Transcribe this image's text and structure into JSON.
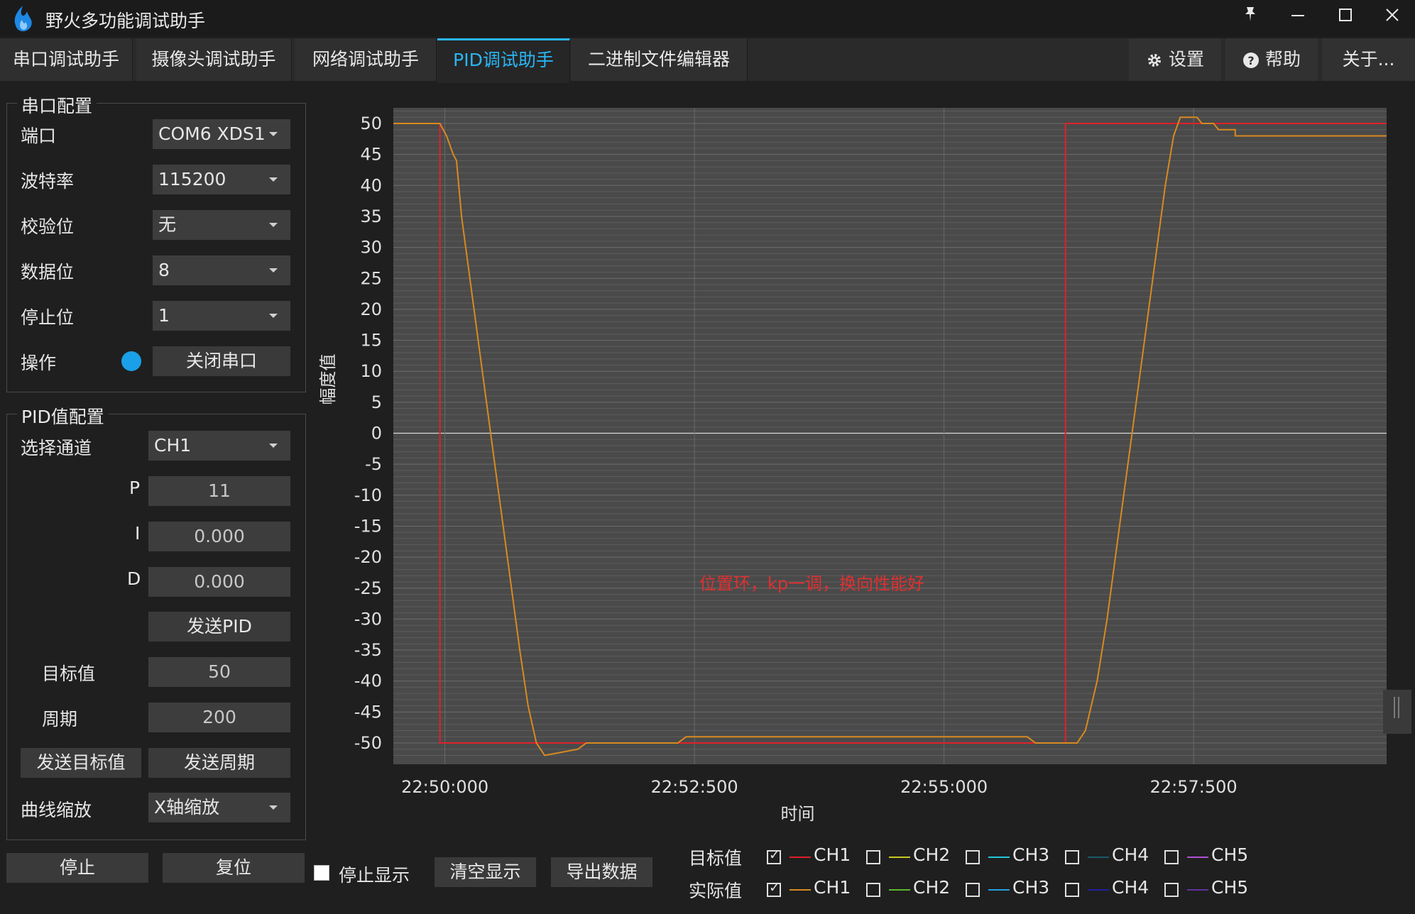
{
  "window": {
    "title": "野火多功能调试助手",
    "pin_icon": "pin-icon",
    "minimize_icon": "minimize-icon",
    "maximize_icon": "maximize-icon",
    "close_icon": "close-icon"
  },
  "tabs": [
    {
      "label": "串口调试助手",
      "active": false
    },
    {
      "label": "摄像头调试助手",
      "active": false
    },
    {
      "label": "网络调试助手",
      "active": false
    },
    {
      "label": "PID调试助手",
      "active": true
    },
    {
      "label": "二进制文件编辑器",
      "active": false
    }
  ],
  "right_tabs": {
    "settings": "设置",
    "help": "帮助",
    "about": "关于..."
  },
  "serial_config": {
    "title": "串口配置",
    "port_label": "端口",
    "port_value": "COM6 XDS1",
    "baud_label": "波特率",
    "baud_value": "115200",
    "parity_label": "校验位",
    "parity_value": "无",
    "databits_label": "数据位",
    "databits_value": "8",
    "stopbits_label": "停止位",
    "stopbits_value": "1",
    "operation_label": "操作",
    "close_port_button": "关闭串口",
    "status_color": "#1aa0e8"
  },
  "pid_config": {
    "title": "PID值配置",
    "channel_label": "选择通道",
    "channel_value": "CH1",
    "p_label": "P",
    "p_value": "11",
    "i_label": "I",
    "i_value": "0.000",
    "d_label": "D",
    "d_value": "0.000",
    "send_pid_button": "发送PID",
    "target_label": "目标值",
    "target_value": "50",
    "period_label": "周期",
    "period_value": "200",
    "send_target_button": "发送目标值",
    "send_period_button": "发送周期",
    "zoom_label": "曲线缩放",
    "zoom_value": "X轴缩放"
  },
  "bottom_controls": {
    "stop_button": "停止",
    "reset_button": "复位",
    "stop_display_label": "停止显示",
    "stop_display_checked": false,
    "clear_display_button": "清空显示",
    "export_data_button": "导出数据"
  },
  "legend": {
    "target_label": "目标值",
    "actual_label": "实际值",
    "target_channels": [
      {
        "name": "CH1",
        "checked": true,
        "color": "#e0202a"
      },
      {
        "name": "CH2",
        "checked": false,
        "color": "#c8c820"
      },
      {
        "name": "CH3",
        "checked": false,
        "color": "#20c8d8"
      },
      {
        "name": "CH4",
        "checked": false,
        "color": "#1a5a6a"
      },
      {
        "name": "CH5",
        "checked": false,
        "color": "#b050d0"
      }
    ],
    "actual_channels": [
      {
        "name": "CH1",
        "checked": true,
        "color": "#d88a20"
      },
      {
        "name": "CH2",
        "checked": false,
        "color": "#5ab82a"
      },
      {
        "name": "CH3",
        "checked": false,
        "color": "#20a0e0"
      },
      {
        "name": "CH4",
        "checked": false,
        "color": "#2020a0"
      },
      {
        "name": "CH5",
        "checked": false,
        "color": "#6030a0"
      }
    ]
  },
  "chart_data": {
    "type": "line",
    "xlabel": "时间",
    "ylabel": "幅度值",
    "ylim": [
      -50,
      50
    ],
    "yticks": [
      50,
      45,
      40,
      35,
      30,
      25,
      20,
      15,
      10,
      5,
      0,
      -5,
      -10,
      -15,
      -20,
      -25,
      -30,
      -35,
      -40,
      -45,
      -50
    ],
    "xticks": [
      "22:50:000",
      "22:52:500",
      "22:55:000",
      "22:57:500"
    ],
    "xtick_values": [
      0,
      150,
      300,
      450
    ],
    "xlim": [
      -31,
      566
    ],
    "annotation": "位置环，kp一调，换向性能好",
    "annotation_color": "#e03030",
    "grid": true,
    "series": [
      {
        "channel": "CH1 目标值",
        "color": "#e0202a",
        "points": [
          [
            -31,
            50
          ],
          [
            -3,
            50
          ],
          [
            -3,
            -50
          ],
          [
            373,
            -50
          ],
          [
            373,
            50
          ],
          [
            566,
            50
          ]
        ]
      },
      {
        "channel": "CH1 实际值",
        "color": "#d88a20",
        "points": [
          [
            -31,
            50
          ],
          [
            -3,
            50
          ],
          [
            1,
            48
          ],
          [
            5,
            45
          ],
          [
            7,
            44
          ],
          [
            10,
            35
          ],
          [
            15,
            25
          ],
          [
            20,
            15
          ],
          [
            25,
            5
          ],
          [
            30,
            -5
          ],
          [
            35,
            -15
          ],
          [
            40,
            -25
          ],
          [
            45,
            -35
          ],
          [
            50,
            -44
          ],
          [
            55,
            -50
          ],
          [
            60,
            -52
          ],
          [
            80,
            -51
          ],
          [
            85,
            -50
          ],
          [
            140,
            -50
          ],
          [
            145,
            -49
          ],
          [
            350,
            -49
          ],
          [
            355,
            -50
          ],
          [
            380,
            -50
          ],
          [
            385,
            -48
          ],
          [
            392,
            -40
          ],
          [
            398,
            -30
          ],
          [
            403,
            -20
          ],
          [
            408,
            -10
          ],
          [
            413,
            0
          ],
          [
            418,
            10
          ],
          [
            423,
            20
          ],
          [
            428,
            30
          ],
          [
            433,
            40
          ],
          [
            438,
            48
          ],
          [
            442,
            51
          ],
          [
            452,
            51
          ],
          [
            455,
            50
          ],
          [
            462,
            50
          ],
          [
            465,
            49
          ],
          [
            475,
            49
          ],
          [
            475,
            48
          ],
          [
            566,
            48
          ]
        ]
      }
    ]
  }
}
